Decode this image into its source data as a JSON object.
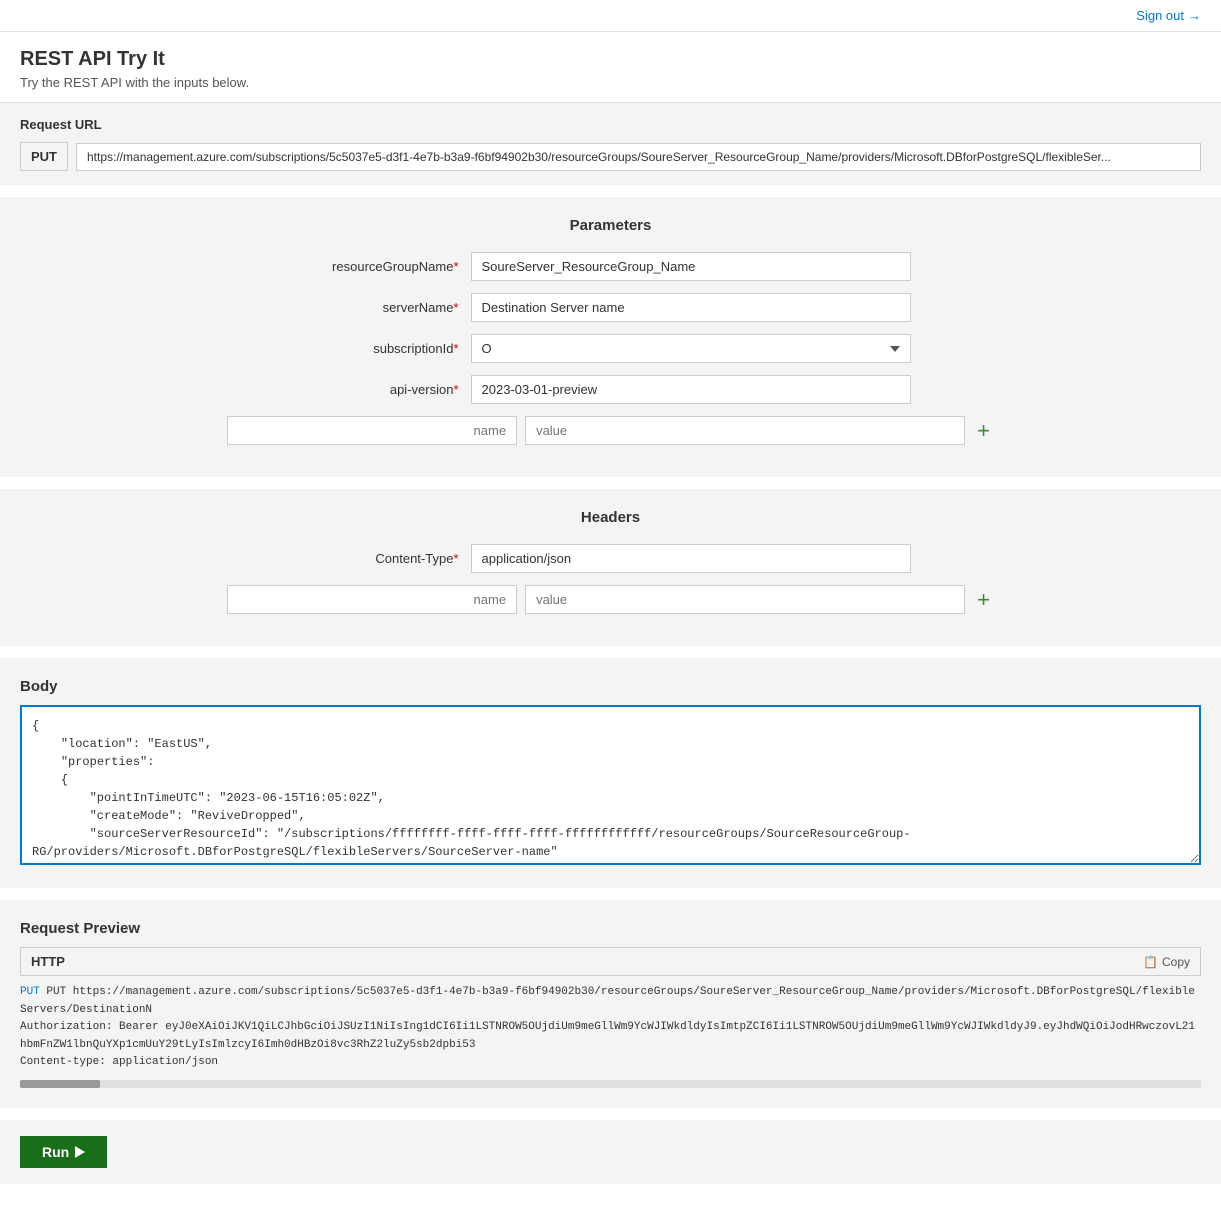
{
  "page": {
    "title": "REST API Try It",
    "subtitle": "Try the REST API with the inputs below."
  },
  "topbar": {
    "sign_out": "Sign out"
  },
  "request_url": {
    "label": "Request URL",
    "method": "PUT",
    "url": "https://management.azure.com/subscriptions/5c5037e5-d3f1-4e7b-b3a9-f6bf94902b30/resourceGroups/SoureServer_ResourceGroup_Name/providers/Microsoft.DBforPostgreSQL/flexibleSer..."
  },
  "parameters": {
    "section_title": "Parameters",
    "resourceGroupName": {
      "label": "resourceGroupName",
      "required": true,
      "value": "SoureServer_ResourceGroup_Name"
    },
    "serverName": {
      "label": "serverName",
      "required": true,
      "value": "Destination Server name"
    },
    "subscriptionId": {
      "label": "subscriptionId",
      "required": true,
      "value": "O",
      "options": [
        "O"
      ]
    },
    "apiVersion": {
      "label": "api-version",
      "required": true,
      "value": "2023-03-01-preview"
    },
    "custom": {
      "name_placeholder": "name",
      "value_placeholder": "value"
    },
    "add_label": "+"
  },
  "headers": {
    "section_title": "Headers",
    "content_type": {
      "label": "Content-Type",
      "required": true,
      "value": "application/json"
    },
    "custom": {
      "name_placeholder": "name",
      "value_placeholder": "value"
    },
    "add_label": "+"
  },
  "body": {
    "label": "Body",
    "content": "{\n    \"location\": \"EastUS\",\n    \"properties\":\n    {\n        \"pointInTimeUTC\": \"2023-06-15T16:05:02Z\",\n        \"createMode\": \"ReviveDropped\",\n        \"sourceServerResourceId\": \"/subscriptions/ffffffff-ffff-ffff-ffff-ffffffffffff/resourceGroups/SourceResourceGroup-RG/providers/Microsoft.DBforPostgreSQL/flexibleServers/SourceServer-name\"\n    }\n}"
  },
  "request_preview": {
    "title": "Request Preview",
    "http_label": "HTTP",
    "copy_label": "Copy",
    "put_line": "PUT https://management.azure.com/subscriptions/5c5037e5-d3f1-4e7b-b3a9-f6bf94902b30/resourceGroups/SoureServer_ResourceGroup_Name/providers/Microsoft.DBforPostgreSQL/flexibleServers/DestinationN",
    "auth_line": "Authorization: Bearer eyJ0eXAiOiJKV1QiLCJhbGciOiJSUzI1NiIsIng1dCI6Ii1LSTNROW5OUjdiUm9meGllWm9YcWJIWkdldyIsImtpZCI6Ii1LSTNROW5OUjdiUm9meGllWm9YcWJIWkdldyJ9.eyJhdWQiOiJodHRwczovL21hbmFnZW1lbnQuYXp1cmUuY29tLyIsImlzcyI6Imh0dHBzOi8vc3RhZ2luZy5sb2dpbi53",
    "content_type_line": "Content-type: application/json"
  },
  "run": {
    "label": "Run"
  }
}
